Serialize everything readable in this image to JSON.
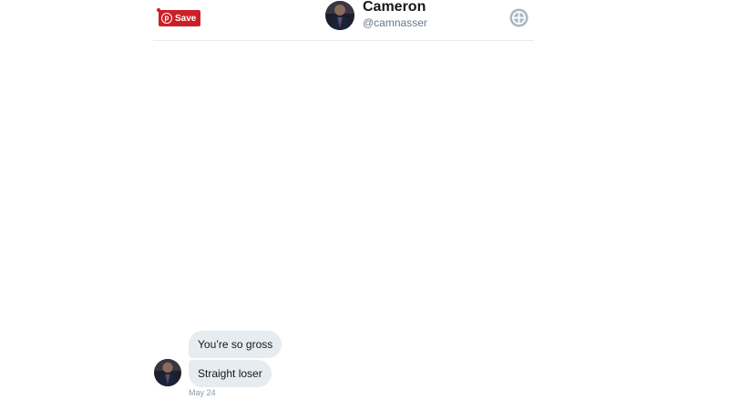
{
  "pin_button": {
    "label": "Save",
    "icon": "pinterest-icon",
    "color": "#cb2027"
  },
  "header": {
    "name": "Cameron",
    "handle": "@camnasser",
    "info_icon": "info-circle-icon"
  },
  "conversation": {
    "messages": [
      {
        "text": "You’re so gross"
      },
      {
        "text": "Straight loser"
      }
    ],
    "timestamp": "May 24"
  },
  "colors": {
    "bubble_bg": "#e6ecf0",
    "text_primary": "#14171a",
    "text_secondary": "#657786",
    "divider": "#e6ecf0"
  }
}
